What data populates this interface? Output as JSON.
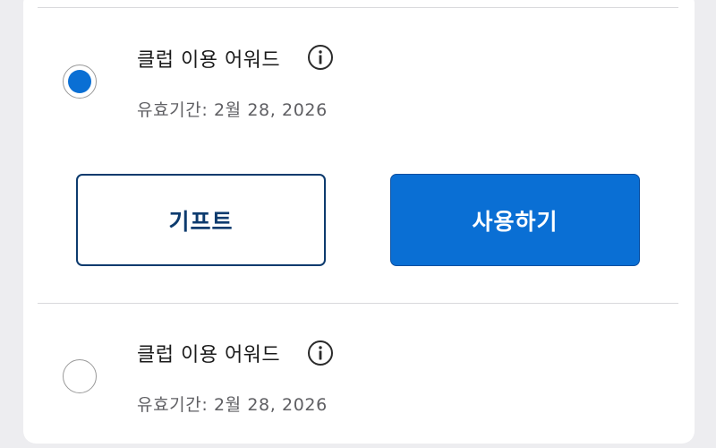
{
  "rewards": [
    {
      "title": "클럽 이용 어워드",
      "expiry": "유효기간: 2월 28, 2026",
      "selected": true,
      "info_icon": "info-circle-icon"
    },
    {
      "title": "클럽 이용 어워드",
      "expiry": "유효기간: 2월 28, 2026",
      "selected": false,
      "info_icon": "info-circle-icon"
    }
  ],
  "actions": {
    "gift_label": "기프트",
    "use_label": "사용하기"
  },
  "colors": {
    "accent": "#0a6fd4",
    "gift_border": "#0d3b6e",
    "divider": "#d9d9dc",
    "page_bg": "#ededf0"
  }
}
